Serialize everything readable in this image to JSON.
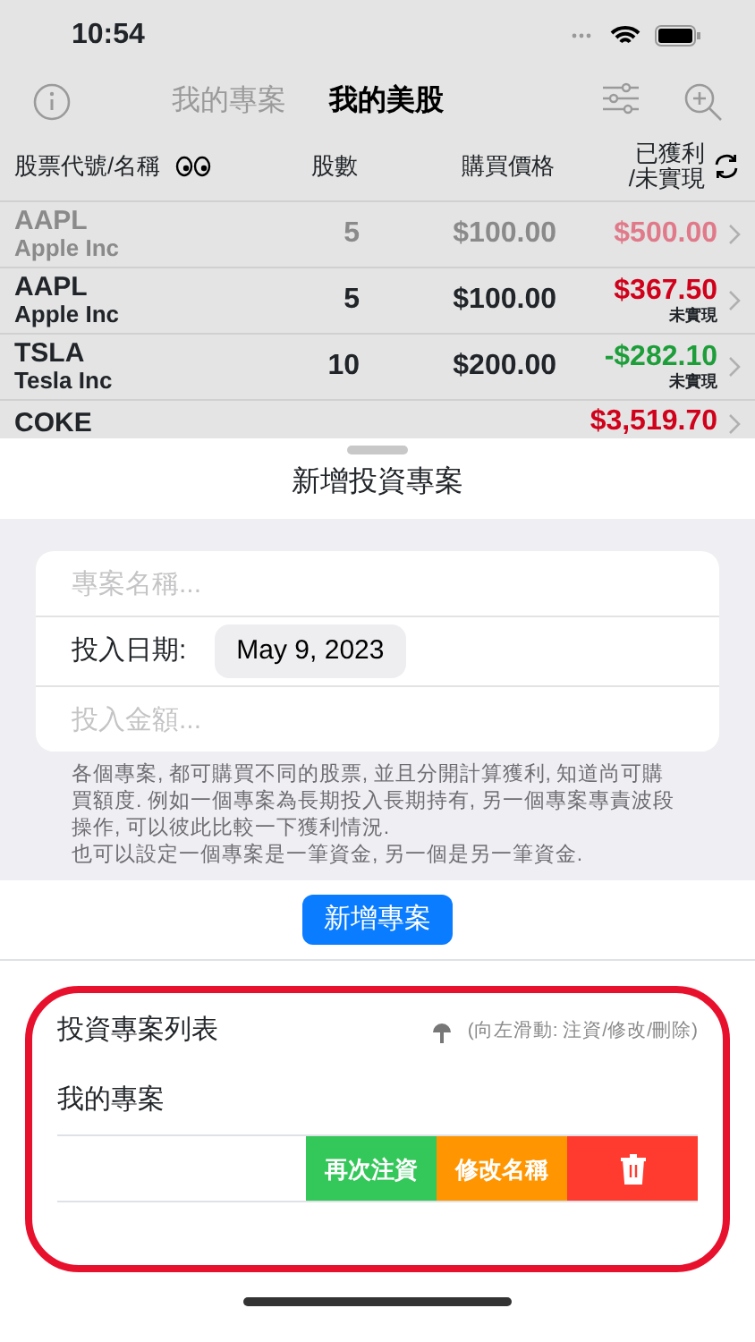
{
  "status_bar": {
    "time": "10:54"
  },
  "nav": {
    "tabs": [
      {
        "label": "我的專案",
        "selected": false
      },
      {
        "label": "我的美股",
        "selected": true
      }
    ]
  },
  "table": {
    "columns": [
      "股票代號/名稱",
      "股數",
      "購買價格",
      "已獲利\n/未實現"
    ],
    "rows": [
      {
        "ticker": "AAPL",
        "name": "Apple Inc",
        "shares": "5",
        "price": "$100.00",
        "profit": "$500.00",
        "color": "#e07a8a",
        "dimmed": true
      },
      {
        "ticker": "AAPL",
        "name": "Apple Inc",
        "shares": "5",
        "price": "$100.00",
        "profit": "$367.50",
        "note": "未實現",
        "color": "#d0021b",
        "dimmed": false
      },
      {
        "ticker": "TSLA",
        "name": "Tesla Inc",
        "shares": "10",
        "price": "$200.00",
        "profit": "-$282.10",
        "note": "未實現",
        "color": "#1e9e3a",
        "dimmed": false
      },
      {
        "ticker": "COKE",
        "profit": "$3,519.70",
        "color": "#d0021b",
        "dimmed": false
      }
    ]
  },
  "sheet": {
    "title": "新增投資專案",
    "form": {
      "name_placeholder": "專案名稱...",
      "date_label": "投入日期:",
      "date_value": "May 9, 2023",
      "amount_placeholder": "投入金額..."
    },
    "note": [
      "各個專案, 都可購買不同的股票, 並且分開計算獲利, 知道尚可購買額度. 例如一個專案為長期投入長期持有, 另一個專案專責波段操作, 可以彼此比較一下獲利情況.",
      "也可以設定一個專案是一筆資金, 另一個是另一筆資金."
    ],
    "add_button": "新增專案",
    "list": {
      "title": "投資專案列表",
      "hint": "(向左滑動: 注資/修改/刪除)",
      "items": [
        {
          "name": "我的專案"
        }
      ],
      "swipe_actions": [
        {
          "kind": "text",
          "label": "再次注資",
          "color": "#34c759"
        },
        {
          "kind": "text",
          "label": "修改名稱",
          "color": "#ff9500"
        },
        {
          "kind": "delete",
          "color": "#ff3b30"
        }
      ]
    }
  }
}
